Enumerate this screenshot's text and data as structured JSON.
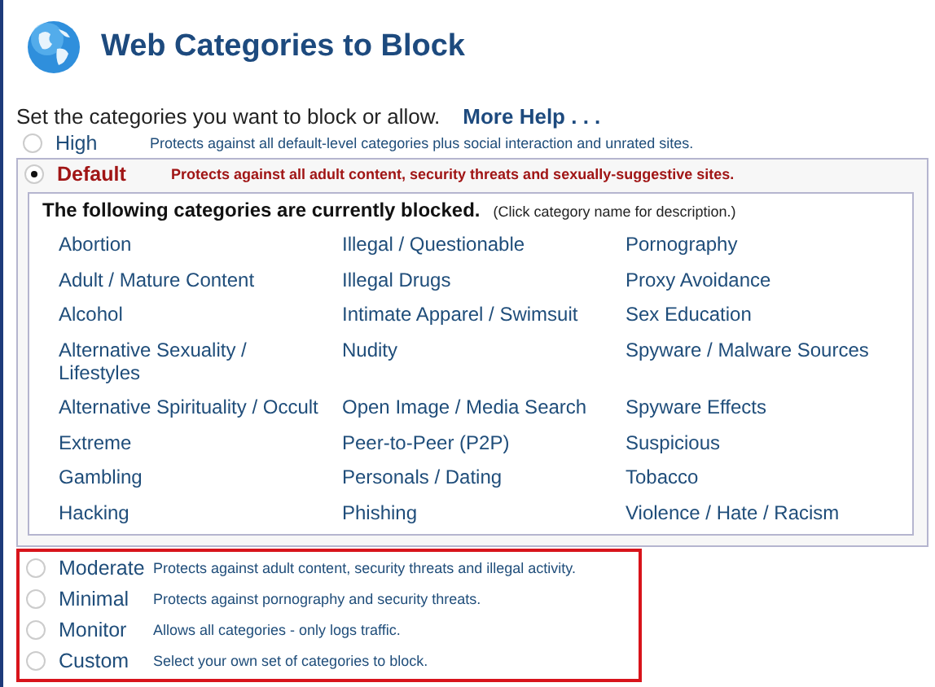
{
  "title": "Web Categories to Block",
  "intro": {
    "text": "Set the categories you want to block or allow.",
    "help_link": "More Help . . ."
  },
  "levels": [
    {
      "label": "High",
      "description": "Protects against all default-level categories plus social interaction and unrated sites.",
      "selected": false,
      "highlighted": false
    },
    {
      "label": "Default",
      "description": "Protects against all adult content, security threats and sexually-suggestive sites.",
      "selected": true,
      "highlighted": false
    },
    {
      "label": "Moderate",
      "description": "Protects against adult content, security threats and illegal activity.",
      "selected": false,
      "highlighted": true
    },
    {
      "label": "Minimal",
      "description": "Protects against pornography and security threats.",
      "selected": false,
      "highlighted": true
    },
    {
      "label": "Monitor",
      "description": "Allows all categories - only logs traffic.",
      "selected": false,
      "highlighted": true
    },
    {
      "label": "Custom",
      "description": "Select your own set of categories to block.",
      "selected": false,
      "highlighted": true
    }
  ],
  "blocked": {
    "heading": "The following categories are currently blocked.",
    "hint": "(Click category name for description.)",
    "rows": [
      [
        "Abortion",
        "Illegal / Questionable",
        "Pornography"
      ],
      [
        "Adult / Mature Content",
        "Illegal Drugs",
        "Proxy Avoidance"
      ],
      [
        "Alcohol",
        "Intimate Apparel / Swimsuit",
        "Sex Education"
      ],
      [
        "Alternative Sexuality / Lifestyles",
        "Nudity",
        "Spyware / Malware Sources"
      ],
      [
        "Alternative Spirituality / Occult",
        "Open Image / Media Search",
        "Spyware Effects"
      ],
      [
        "Extreme",
        "Peer-to-Peer (P2P)",
        "Suspicious"
      ],
      [
        "Gambling",
        "Personals / Dating",
        "Tobacco"
      ],
      [
        "Hacking",
        "Phishing",
        "Violence / Hate / Racism"
      ]
    ]
  }
}
